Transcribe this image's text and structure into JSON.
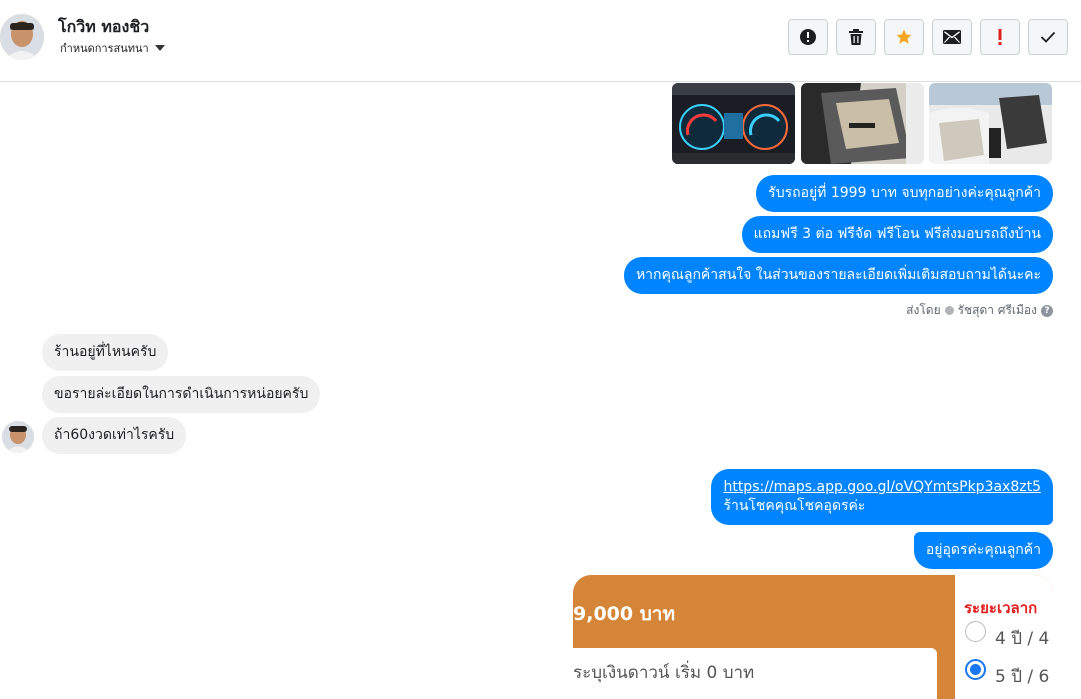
{
  "header": {
    "contact_name": "โกวิท ทองชิว",
    "assign_label": "กำหนดการสนทนา",
    "actions": [
      {
        "name": "report-button",
        "icon": "alert-circle-icon"
      },
      {
        "name": "delete-button",
        "icon": "trash-icon"
      },
      {
        "name": "star-button",
        "icon": "star-icon"
      },
      {
        "name": "mark-unread-button",
        "icon": "envelope-icon"
      },
      {
        "name": "important-button",
        "icon": "exclamation-icon"
      },
      {
        "name": "done-button",
        "icon": "check-icon"
      }
    ]
  },
  "colors": {
    "outgoing_bubble": "#0084ff",
    "incoming_bubble": "#f0f0f0",
    "star": "#f5a623",
    "important": "#e02020",
    "promo_bg": "#d58537"
  },
  "messages": {
    "out_1": "รับรถอยู่ที่ 1999 บาท จบทุกอย่างค่ะคุณลูกค้า",
    "out_2": "แถมฟรี 3 ต่อ ฟรีจัด ฟรีโอน  ฟรีส่งมอบรถถึงบ้าน",
    "out_3": "หากคุณลูกค้าสนใจ ในส่วนของรายละเอียดเพิ่มเติมสอบถามได้นะคะ",
    "sent_by_label": "ส่งโดย",
    "sent_by_name": "รัชสุดา ศรีเมือง",
    "in_1": "ร้านอยู่ที่ไหนครับ",
    "in_2": "ขอรายล่ะเอียดในการดำเนินการหน่อยครับ",
    "in_3": "ถ้า60งวดเท่าไรครับ",
    "out_4_link": "https://maps.app.goo.gl/oVQYmtsPkp3ax8zt5",
    "out_4_text": "ร้านโชคคุณโชคอุดรค่ะ",
    "out_5": "อยู่อุดรค่ะคุณลูกค้า"
  },
  "promo": {
    "price": "9,000 บาท",
    "down_payment": "ระบุเงินดาวน์ เริ่ม 0 บาท",
    "period_label": "ระยะเวลาก",
    "option_1": "4 ปี / 4",
    "option_2": "5 ปี / 6",
    "selected_option": 2
  }
}
